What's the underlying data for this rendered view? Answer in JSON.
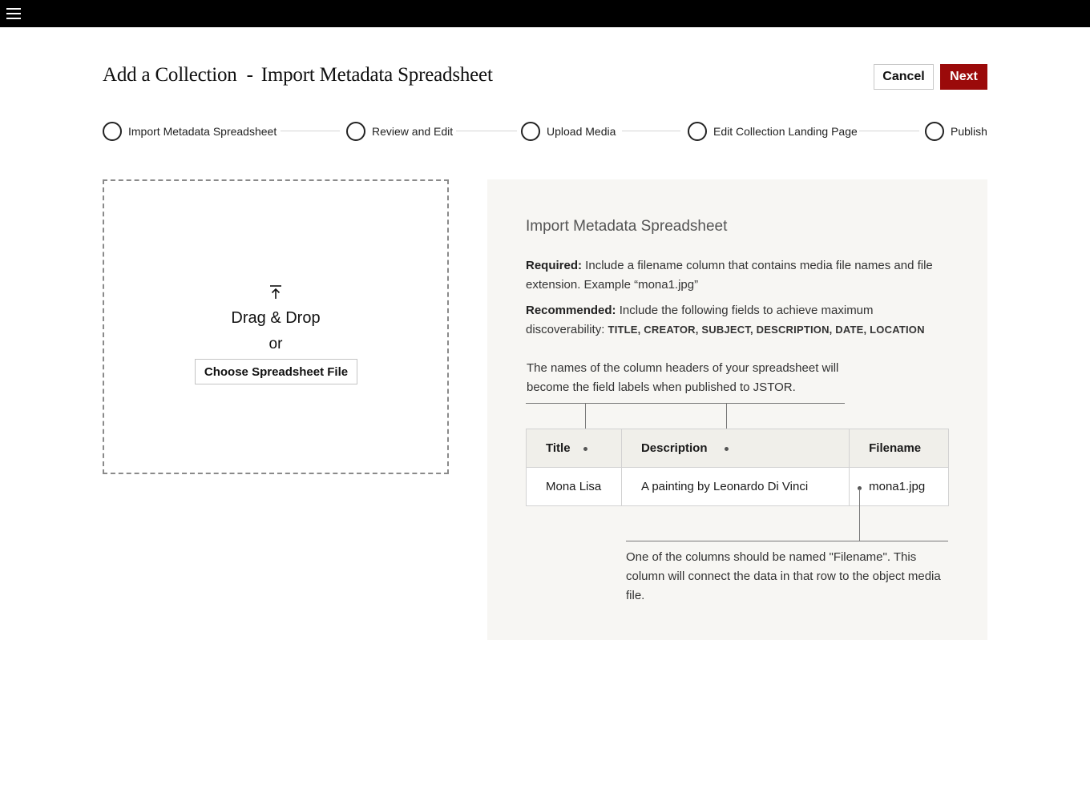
{
  "topbar": {
    "menu_icon": "hamburger-menu-icon"
  },
  "header": {
    "title": "Add a Collection",
    "separator": "-",
    "subtitle": "Import Metadata Spreadsheet",
    "cancel_label": "Cancel",
    "next_label": "Next",
    "accent_color": "#9b0a0a"
  },
  "steps": [
    {
      "label": "Import Metadata Spreadsheet"
    },
    {
      "label": "Review and Edit"
    },
    {
      "label": "Upload Media"
    },
    {
      "label": "Edit Collection Landing Page"
    },
    {
      "label": "Publish"
    }
  ],
  "dropzone": {
    "icon": "upload-icon",
    "title": "Drag & Drop",
    "or": "or",
    "button_label": "Choose Spreadsheet File"
  },
  "info": {
    "title": "Import Metadata Spreadsheet",
    "required_label": "Required:",
    "required_text": " Include a filename column that contains media file names and file extension. Example “mona1.jpg”",
    "recommended_label": "Recommended:",
    "recommended_text": " Include the following fields to achieve maximum discoverability: ",
    "recommended_fields": "TITLE, CREATOR, SUBJECT, DESCRIPTION, DATE, LOCATION",
    "headers_note": "The names of the column headers of your spreadsheet will become the field labels when published to JSTOR.",
    "table": {
      "headers": [
        "Title",
        "Description",
        "Filename"
      ],
      "row": [
        "Mona Lisa",
        "A painting by Leonardo Di Vinci",
        "mona1.jpg"
      ]
    },
    "filename_note": "One of the columns should be named \"Filename\".  This column will connect the data in that row to the object media file."
  }
}
